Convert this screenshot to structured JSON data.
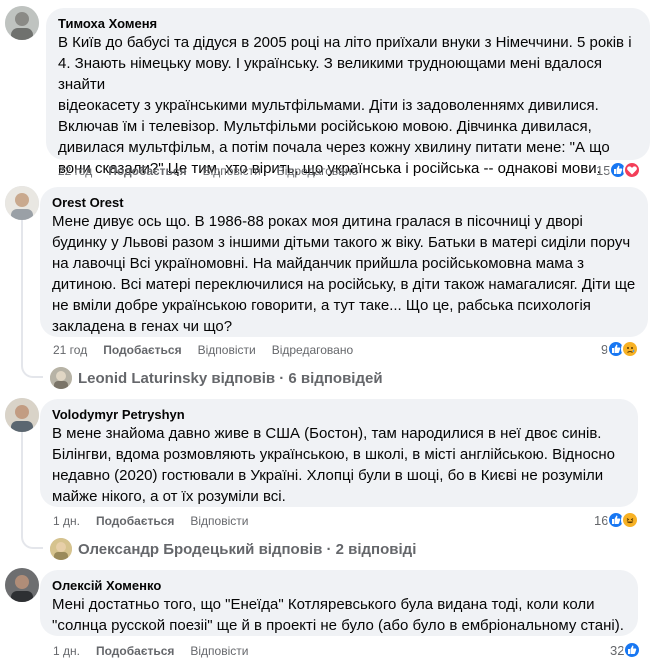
{
  "comments": [
    {
      "author": "Тимоха Хоменя",
      "text": "В Київ до бабусі та дідуся в 2005 році на літо приїхали внуки з Німеччини. 5 років і\n4. Знають німецьку мову. І українську. З великими трудноющами мені вдалося знайти\nвідеокасету з українськими мультфільмами. Діти із задоволеннямх дивилися.\nВключав їм і телевізор. Мультфільми російською мовою. Дівчинка дивилася,\nдивилася мультфільм, а потім почала через кожну хвилину питати мене: \"А що\nвони сказали?\" Це тим, хто вірить, що українська і російська -- однакові мови.",
      "time": "22 год",
      "like": "Подобається",
      "reply": "Відповісти",
      "edited": "Відредаговано",
      "reaction_count": "15",
      "reactions": [
        "like-icon",
        "love-icon"
      ]
    },
    {
      "author": "Orest Orest",
      "text": "Мене дивує ось що. В 1986-88 роках моя дитина гралася в пісочниці у дворі\nбудинку у Львові разом з іншими дітьми такого ж віку. Батьки в матері сиділи поруч\nна лавочці Всі україномовні. На майданчик прийшла російськомовна мама з\nдитиною. Всі матері переключилися на російську, в діти також намагалисяг. Діти ще\nне вміли добре українською говорити, а тут таке... Що це, рабська психологія\nзакладена в генах чи що?",
      "time": "21 год",
      "like": "Подобається",
      "reply": "Відповісти",
      "edited": "Відредаговано",
      "reaction_count": "9",
      "reactions": [
        "like-icon",
        "sad-icon"
      ],
      "replies_line": "Leonid Laturinsky відповів · 6 відповідей"
    },
    {
      "author": "Volodymyr Petryshyn",
      "text": "В мене знайома давно живе в США (Бостон), там народилися в неї двоє синів.\nБілінгви, вдома розмовляють українською, в школі, в місті англійською. Відносно\nнедавно (2020) гостювали в Україні. Хлопці були в шоці, бо в Києві не розуміли\nмайже нікого, а от їх розуміли всі.",
      "time": "1 дн.",
      "like": "Подобається",
      "reply": "Відповісти",
      "reaction_count": "16",
      "reactions": [
        "like-icon",
        "haha-icon"
      ],
      "replies_line": "Олександр Бродецький відповів · 2 відповіді"
    },
    {
      "author": "Олексій Хоменко",
      "text": "Мені достатньо того, що \"Енеїда\" Котляревського була видана тоді, коли коли\n\"солнца русской поезіі\" ще й в проекті не було (або було в ембріональному стані).",
      "time": "1 дн.",
      "like": "Подобається",
      "reply": "Відповісти",
      "reaction_count": "32",
      "reactions": [
        "like-icon"
      ]
    }
  ],
  "colors": {
    "bubble": "#f0f2f5",
    "meta_text": "#65676b",
    "like_blue": "#1877f2",
    "love_red": "#f33e58",
    "emoji_yellow": "#f7b125"
  }
}
